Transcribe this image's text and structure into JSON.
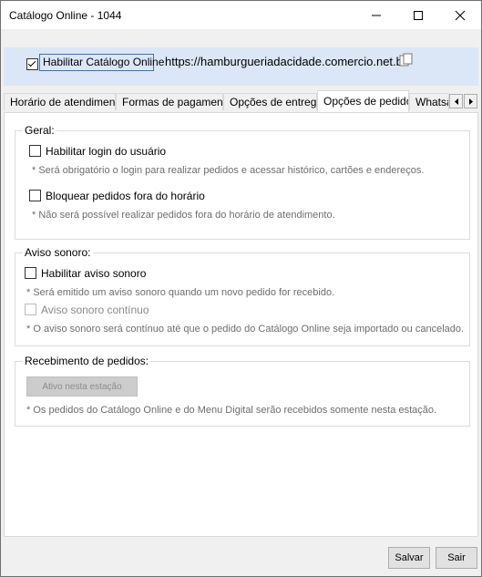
{
  "window": {
    "title": "Catálogo Online - 1044"
  },
  "top": {
    "enable_label": "Habilitar Catálogo Online",
    "enable_checked": true,
    "url": "https://hamburgueriadacidade.comercio.net.br"
  },
  "tabs": [
    {
      "label": "Horário de atendimento"
    },
    {
      "label": "Formas de pagamento"
    },
    {
      "label": "Opções de entrega"
    },
    {
      "label": "Opções de pedido",
      "active": true
    },
    {
      "label": "Whatsapp"
    }
  ],
  "geral": {
    "title": "Geral:",
    "login_label": "Habilitar login do usuário",
    "login_note": "* Será obrigatório o login para realizar pedidos e acessar histórico, cartões e endereços.",
    "bloquear_label": "Bloquear pedidos fora do horário",
    "bloquear_note": "* Não será possível realizar pedidos fora do horário de atendimento."
  },
  "aviso": {
    "title": "Aviso sonoro:",
    "habilitar_label": "Habilitar aviso sonoro",
    "habilitar_note": "* Será emitido um aviso sonoro quando um novo pedido for recebido.",
    "continuo_label": "Aviso sonoro contínuo",
    "continuo_note": "* O aviso sonoro será contínuo até que o pedido do Catálogo Online seja importado ou cancelado."
  },
  "recebimento": {
    "title": "Recebimento de pedidos:",
    "button_label": "Ativo nesta estação",
    "note": "* Os pedidos do Catálogo Online e do Menu Digital serão recebidos somente nesta estação."
  },
  "footer": {
    "save_label": "Salvar",
    "exit_label": "Sair"
  },
  "icons": {
    "copy": "copy-icon",
    "minimize": "minimize-icon",
    "maximize": "maximize-icon",
    "close": "close-icon"
  }
}
